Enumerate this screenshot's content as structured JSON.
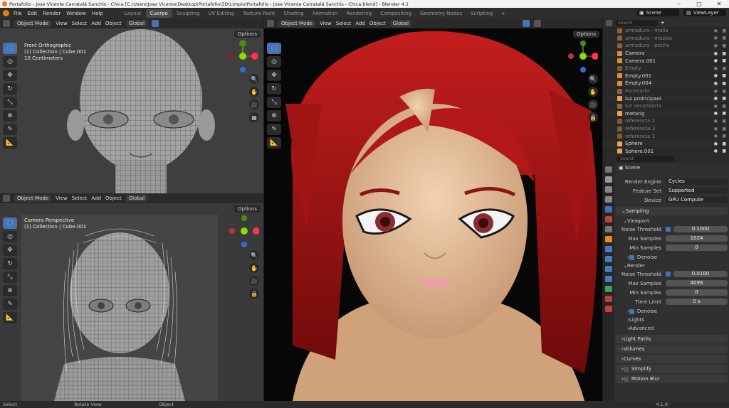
{
  "window": {
    "title": "Portafolio - Jose Vicente Carratalá Sanchis - Chica [C:\\Users\\Jose Vicente\\Desktop\\Portafolio\\3D\\Limpio\\Portafolio - Jose Vicente Carratalá Sanchis - Chica.blend] - Blender 4.1"
  },
  "menu": [
    "File",
    "Edit",
    "Render",
    "Window",
    "Help"
  ],
  "workspaces": [
    {
      "label": "Layout"
    },
    {
      "label": "Cuerpo",
      "active": true
    },
    {
      "label": "Sculpting"
    },
    {
      "label": "UV Editing"
    },
    {
      "label": "Texture Paint"
    },
    {
      "label": "Shading"
    },
    {
      "label": "Animation"
    },
    {
      "label": "Rendering"
    },
    {
      "label": "Compositing"
    },
    {
      "label": "Geometry Nodes"
    },
    {
      "label": "Scripting"
    },
    {
      "label": "+"
    }
  ],
  "scene": "Scene",
  "view_layer": "ViewLayer",
  "vp_front": {
    "mode": "Object Mode",
    "menus": [
      "View",
      "Select",
      "Add",
      "Object"
    ],
    "orientation": "Global",
    "options": "Options",
    "view": "Front Orthographic",
    "collection": "(1) Collection | Cube.001",
    "scale": "10 Centimeters"
  },
  "vp_camera": {
    "mode": "Object Mode",
    "menus": [
      "View",
      "Select",
      "Add",
      "Object"
    ],
    "orientation": "Global",
    "options": "Options",
    "view": "Camera Perspective",
    "collection": "(1) Collection | Cube.001"
  },
  "vp_render": {
    "mode": "Object Mode",
    "menus": [
      "View",
      "Select",
      "Add",
      "Object"
    ],
    "orientation": "Global",
    "options": "Options"
  },
  "outliner": {
    "search_placeholder": "Search",
    "items": [
      {
        "name": "armadura - malla",
        "dim": true,
        "color": "#f0a050"
      },
      {
        "name": "armadura - muslos",
        "dim": true,
        "color": "#f0a050"
      },
      {
        "name": "armadura - pecho",
        "dim": true,
        "color": "#f0a050"
      },
      {
        "name": "Camera",
        "dim": false,
        "color": "#d89040"
      },
      {
        "name": "Camera.001",
        "dim": false,
        "color": "#d89040"
      },
      {
        "name": "Empty",
        "dim": true,
        "color": "#d89040"
      },
      {
        "name": "Empty.001",
        "dim": false,
        "color": "#d89040"
      },
      {
        "name": "Empty.004",
        "dim": false,
        "color": "#d89040"
      },
      {
        "name": "escenario",
        "dim": true,
        "color": "#f0a050"
      },
      {
        "name": "luz proincipaol",
        "dim": false,
        "color": "#f0a050"
      },
      {
        "name": "luz secundaria",
        "dim": true,
        "color": "#f0a050"
      },
      {
        "name": "metarig",
        "dim": false,
        "color": "#f0a050"
      },
      {
        "name": "referencia 2",
        "dim": true,
        "color": "#d89040"
      },
      {
        "name": "referencia 3",
        "dim": true,
        "color": "#d89040"
      },
      {
        "name": "referencia 1",
        "dim": true,
        "color": "#d89040"
      },
      {
        "name": "Sphere",
        "dim": false,
        "color": "#f0a050"
      },
      {
        "name": "Sphere.001",
        "dim": false,
        "color": "#f0a050"
      }
    ]
  },
  "properties": {
    "search_placeholder": "Search",
    "header": "Scene",
    "render_engine_label": "Render Engine",
    "render_engine": "Cycles",
    "feature_set_label": "Feature Set",
    "feature_set": "Supported",
    "device_label": "Device",
    "device": "GPU Compute",
    "sampling": "Sampling",
    "viewport": "Viewport",
    "noise_threshold_label": "Noise Threshold",
    "vp_noise": "0.1000",
    "max_samples_label": "Max Samples",
    "vp_max": "1024",
    "min_samples_label": "Min Samples",
    "vp_min": "0",
    "denoise": "Denoise",
    "render": "Render",
    "r_noise": "0.0100",
    "r_max": "4096",
    "r_min": "0",
    "time_limit_label": "Time Limit",
    "r_time": "0 s",
    "lights": "Lights",
    "advanced": "Advanced",
    "light_paths": "Light Paths",
    "volumes": "Volumes",
    "curves": "Curves",
    "simplify": "Simplify",
    "motion_blur": "Motion Blur"
  },
  "status": {
    "select": "Select",
    "rotate": "Rotate View",
    "object": "Object",
    "version": "4.1.0"
  }
}
